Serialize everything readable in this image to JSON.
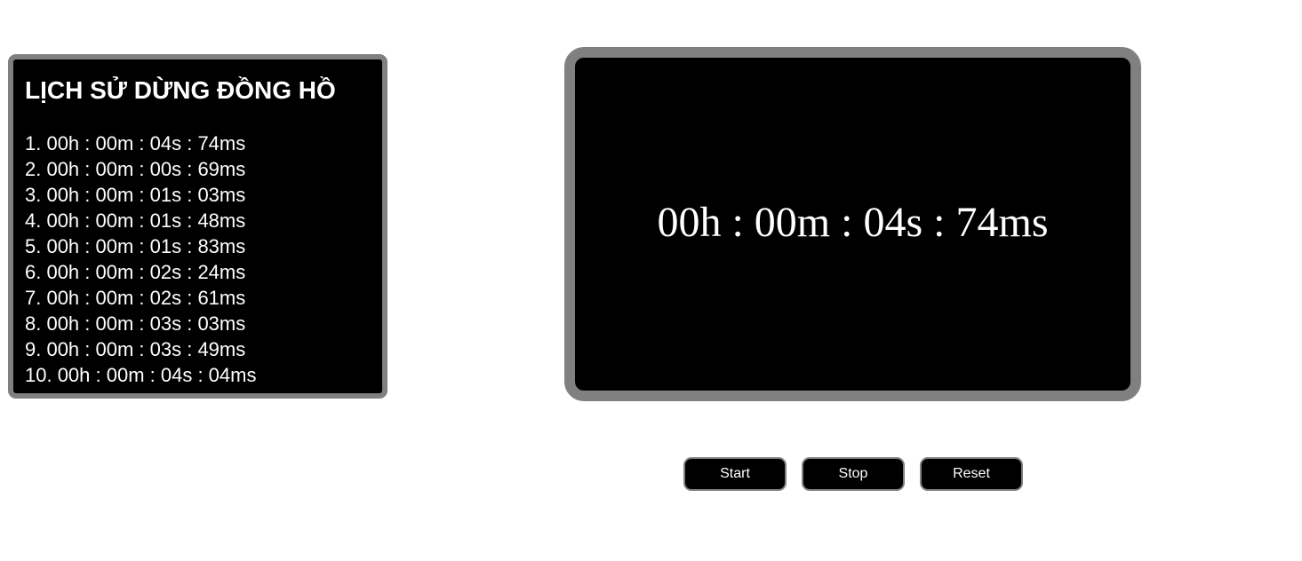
{
  "history": {
    "title": "LỊCH SỬ DỪNG ĐỒNG HỒ",
    "items": [
      "1. 00h : 00m : 04s : 74ms",
      "2. 00h : 00m : 00s : 69ms",
      "3. 00h : 00m : 01s : 03ms",
      "4. 00h : 00m : 01s : 48ms",
      "5. 00h : 00m : 01s : 83ms",
      "6. 00h : 00m : 02s : 24ms",
      "7. 00h : 00m : 02s : 61ms",
      "8. 00h : 00m : 03s : 03ms",
      "9. 00h : 00m : 03s : 49ms",
      "10. 00h : 00m : 04s : 04ms"
    ]
  },
  "stopwatch": {
    "display": "00h : 00m : 04s : 74ms"
  },
  "controls": {
    "start_label": "Start",
    "stop_label": "Stop",
    "reset_label": "Reset"
  },
  "colors": {
    "panel_background": "#000000",
    "panel_border": "#808080",
    "text": "#ffffff",
    "page_background": "#ffffff"
  }
}
